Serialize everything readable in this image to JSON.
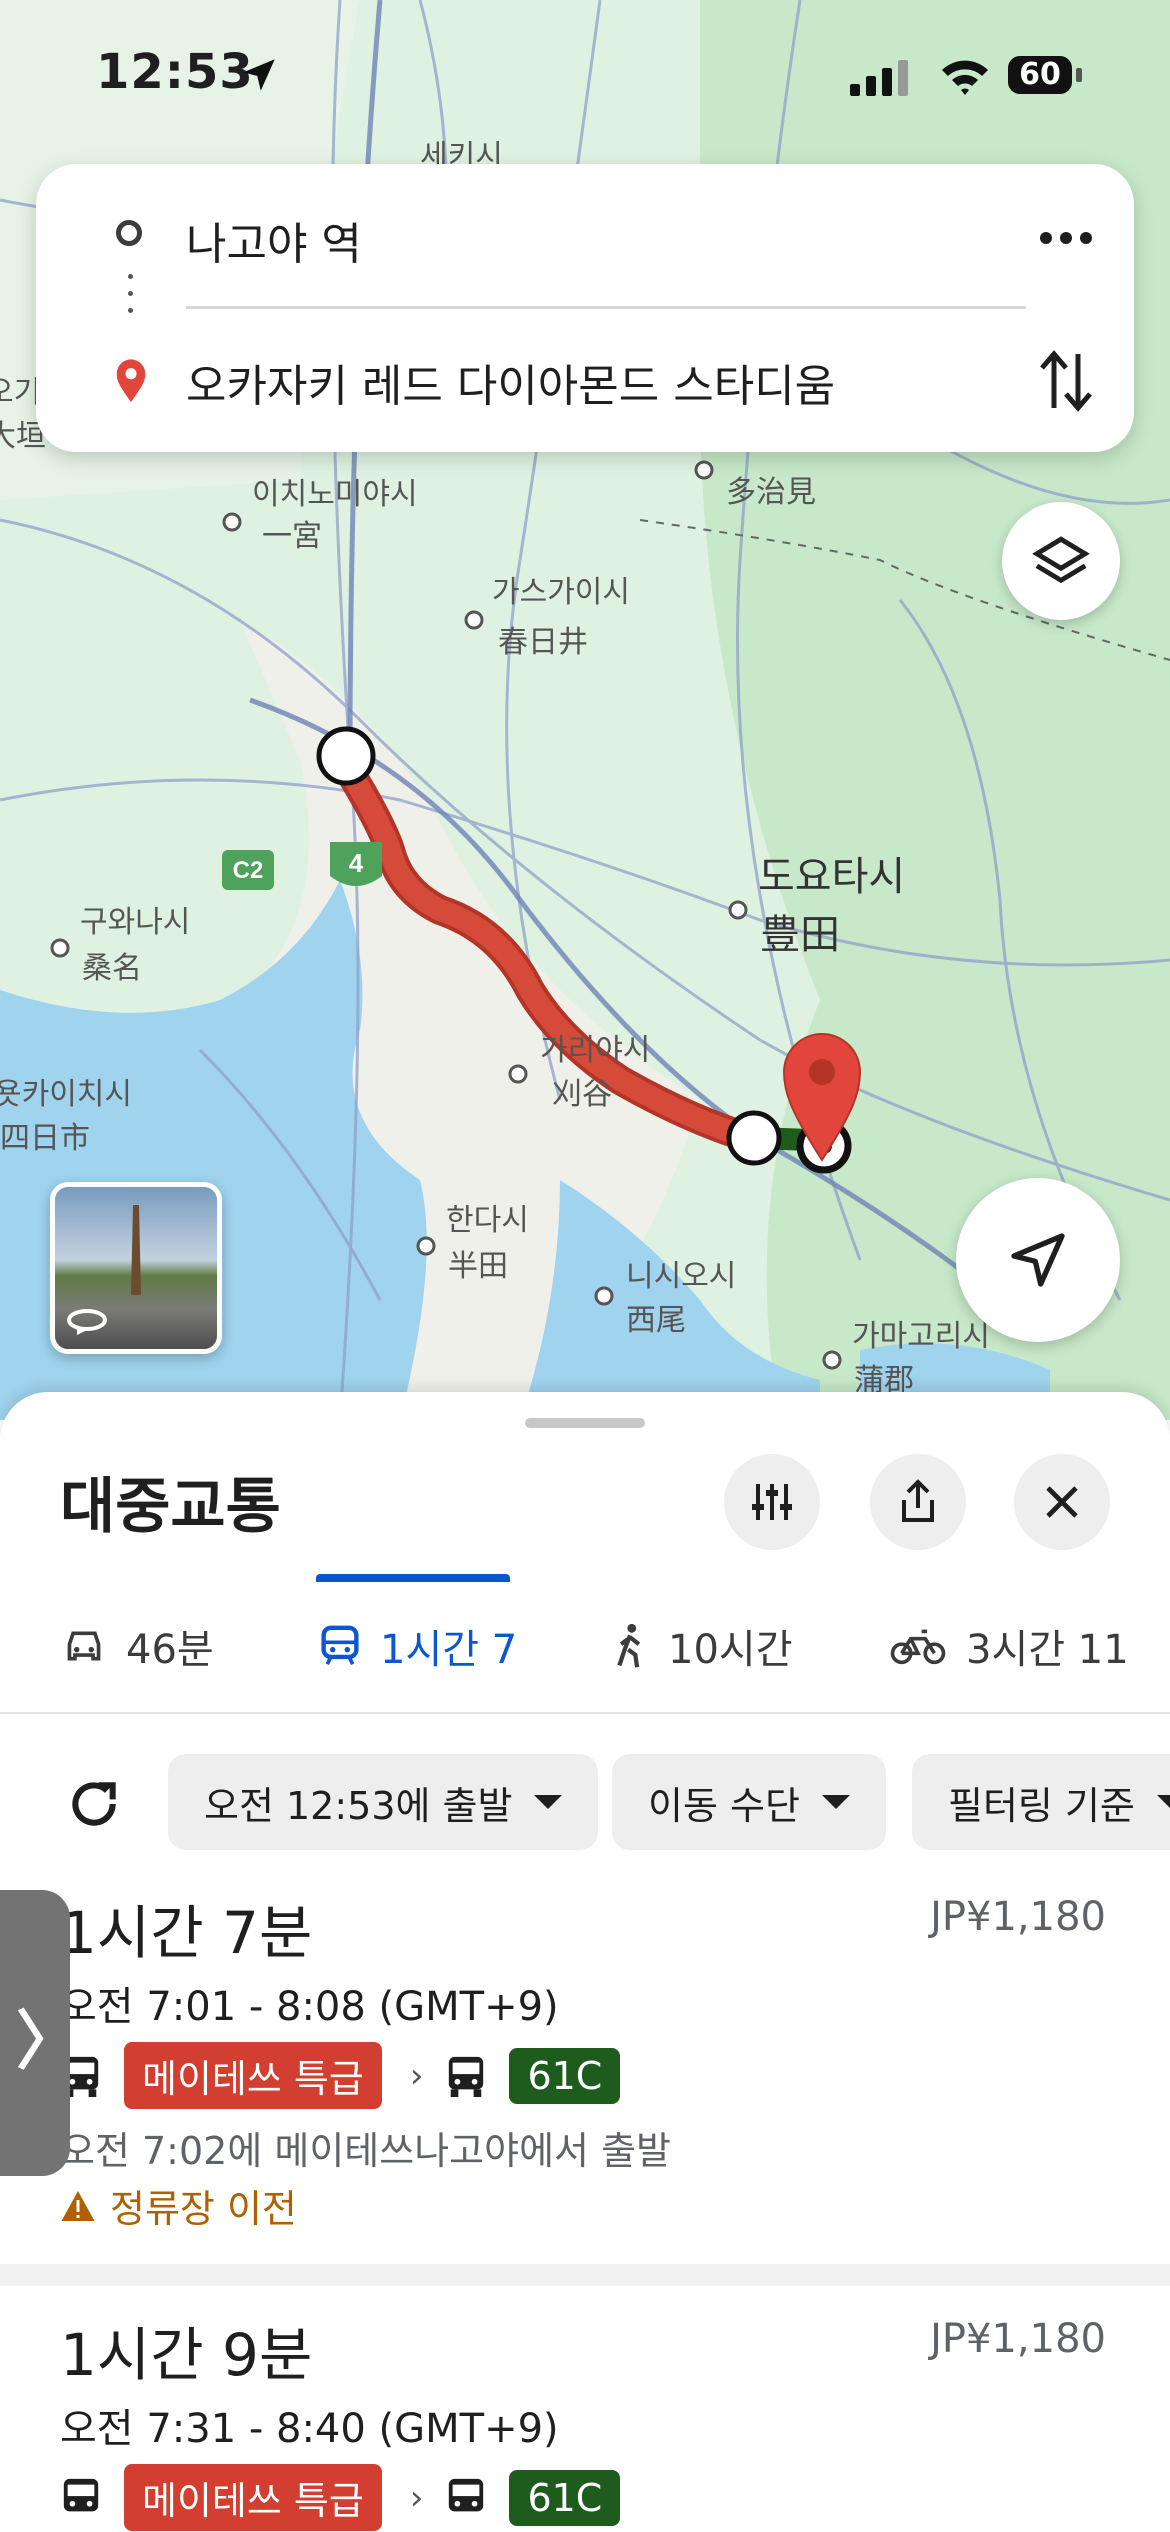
{
  "status_bar": {
    "time": "12:53",
    "battery": "60",
    "location_icon": "location-arrow-icon",
    "signal_icon": "cell-signal-icon",
    "wifi_icon": "wifi-icon"
  },
  "search": {
    "origin": "나고야 역",
    "destination": "오카자키 레드 다이아몬드 스타디움",
    "more_icon": "more-horizontal-icon",
    "swap_icon": "swap-vertical-icon"
  },
  "map": {
    "labels": {
      "top_city": "세키시",
      "tajimi": "多治見",
      "ichinomiya_ko": "이치노미야시",
      "ichinomiya_jp": "一宮",
      "kasugai_ko": "가스가이시",
      "kasugai_jp": "春日井",
      "toyota_ko": "도요타시",
      "toyota_jp": "豊田",
      "kuwana_ko": "구와나시",
      "kuwana_jp": "桑名",
      "kariya_ko": "가리야시",
      "kariya_jp": "刈谷",
      "yokkaichi_ko": "욧카이치시",
      "yokkaichi_jp": "四日市",
      "handa_ko": "한다시",
      "handa_jp": "半田",
      "nishio_ko": "니시오시",
      "nishio_jp": "西尾",
      "gamagori_ko": "가마고리시",
      "gamagori_jp": "蒲郡",
      "ogaki_jp": "大垣",
      "ogaki_ko": "오기",
      "road_c2": "C2",
      "road_4": "4",
      "edge_right": "오"
    },
    "colors": {
      "land": "#dff2e1",
      "water": "#9fd3ee",
      "route": "#d64a3a",
      "walk": "#1e5c1e",
      "pin": "#e1453b"
    }
  },
  "sheet": {
    "title": "대중교통",
    "filter_icon": "tune-sliders-icon",
    "share_icon": "share-icon",
    "close_icon": "close-icon",
    "tabs": [
      {
        "label": "46분",
        "icon": "car-icon"
      },
      {
        "label": "1시간 7",
        "icon": "transit-icon"
      },
      {
        "label": "10시간",
        "icon": "walk-icon"
      },
      {
        "label": "3시간 11",
        "icon": "bike-icon"
      }
    ],
    "filters": {
      "depart": "오전 12:53에 출발",
      "mode": "이동 수단",
      "filter": "필터링 기준"
    },
    "routes": [
      {
        "duration": "1시간 7분",
        "price": "JP¥1,180",
        "times": "오전 7:01 - 8:08 (GMT+9)",
        "leg1": "메이테쓰 특급",
        "leg2": "61C",
        "depart_text": "오전 7:02에 메이테쓰나고야에서 출발",
        "alert": "정류장 이전"
      },
      {
        "duration": "1시간 9분",
        "price": "JP¥1,180",
        "times": "오전 7:31 - 8:40 (GMT+9)",
        "leg1": "메이테쓰 특급",
        "leg2": "61C"
      }
    ],
    "side_tab": "〉"
  }
}
